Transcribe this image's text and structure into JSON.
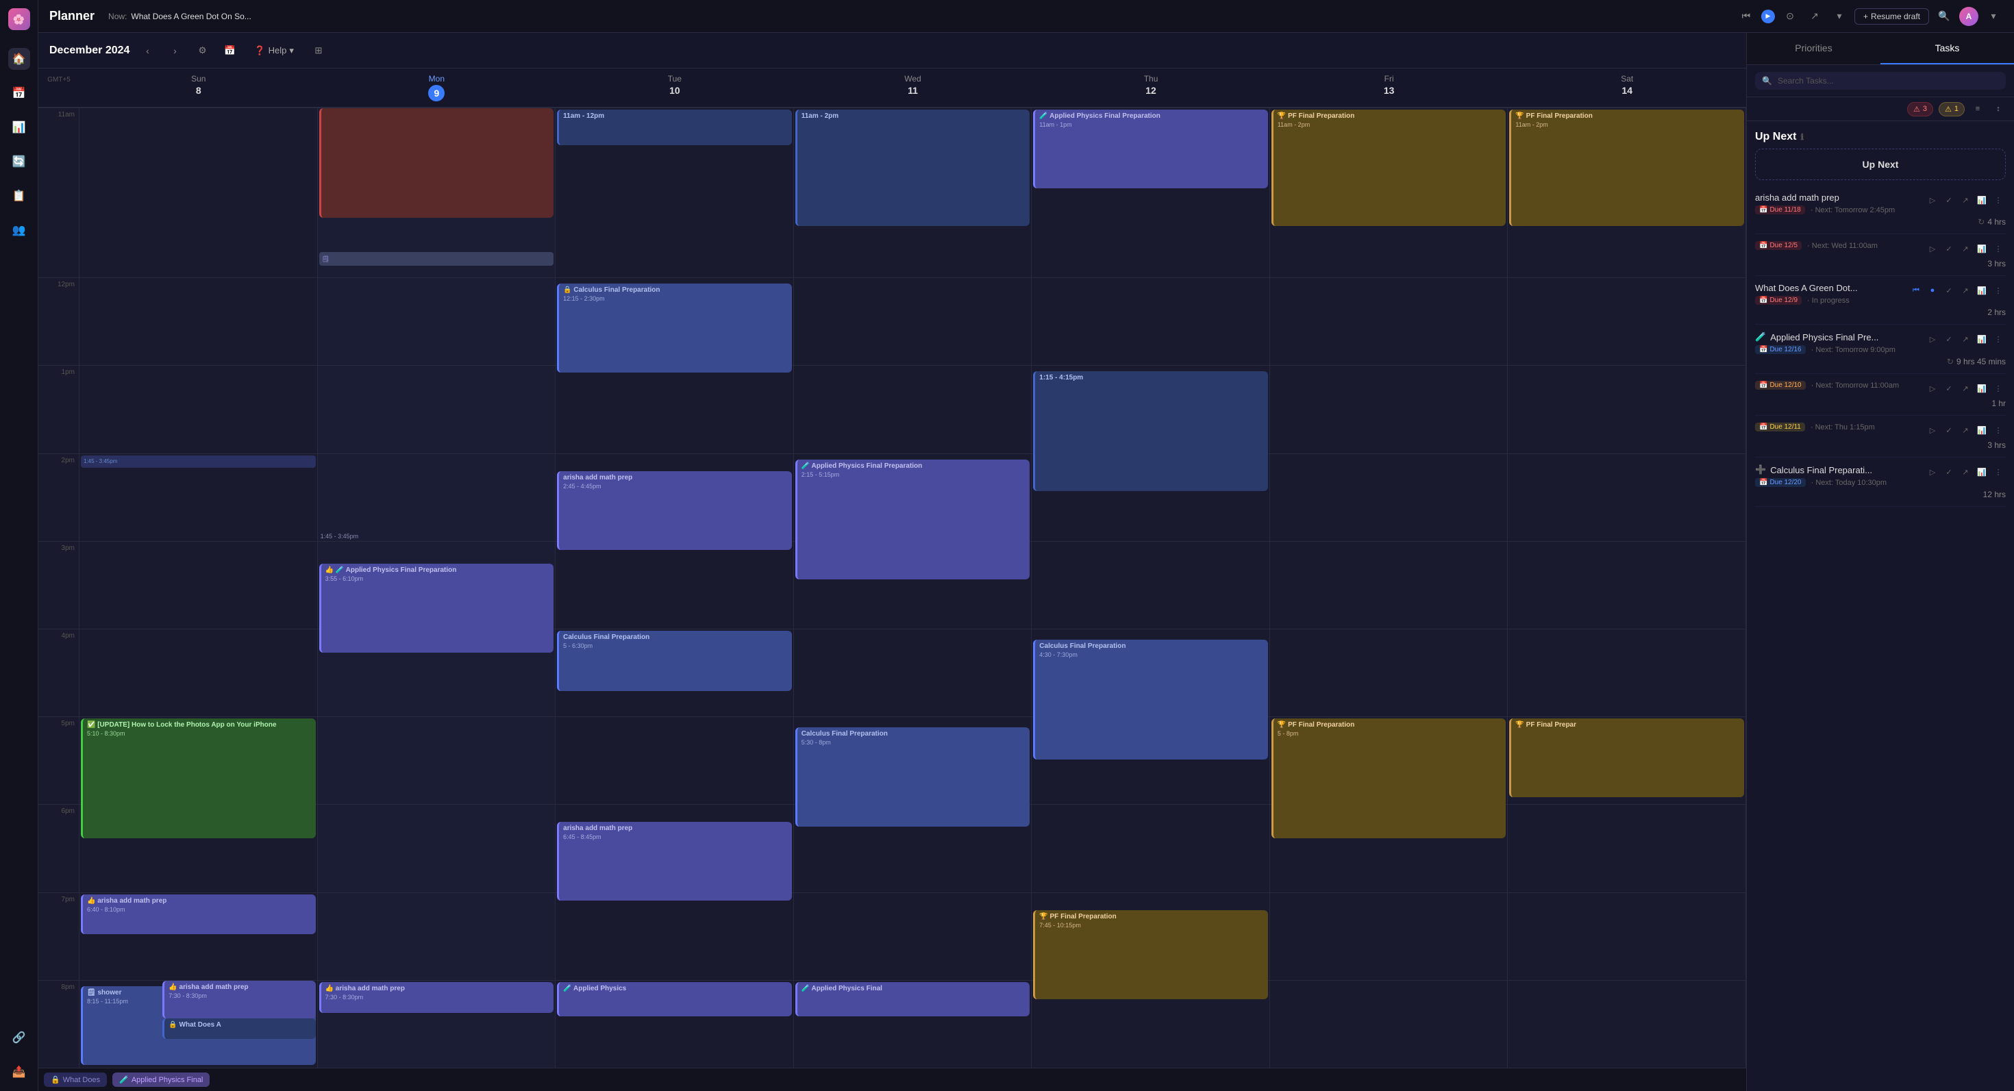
{
  "app": {
    "title": "Planner",
    "now_label": "Now:",
    "now_text": "What Does A Green Dot On So..."
  },
  "header_controls": {
    "resume_draft": "Resume draft",
    "search_placeholder": "Search Tasks..."
  },
  "calendar": {
    "month": "December 2024",
    "timezone": "GMT+5",
    "days": [
      {
        "name": "Sun",
        "num": "8",
        "today": false
      },
      {
        "name": "Mon",
        "num": "9",
        "today": true
      },
      {
        "name": "Tue",
        "num": "10",
        "today": false
      },
      {
        "name": "Wed",
        "num": "11",
        "today": false
      },
      {
        "name": "Thu",
        "num": "12",
        "today": false
      },
      {
        "name": "Fri",
        "num": "13",
        "today": false
      },
      {
        "name": "Sat",
        "num": "14",
        "today": false
      }
    ],
    "time_slots": [
      "11am",
      "12pm",
      "1pm",
      "2pm",
      "3pm",
      "4pm",
      "5pm",
      "6pm",
      "7pm",
      "8pm"
    ]
  },
  "panel": {
    "tabs": [
      "Priorities",
      "Tasks"
    ],
    "active_tab": "Tasks",
    "search_placeholder": "Search Tasks...",
    "filter_red_count": "3",
    "filter_yellow_count": "1"
  },
  "up_next": {
    "title": "Up Next",
    "box_text": "Up Next"
  },
  "tasks": [
    {
      "id": 1,
      "title": "arisha add math prep",
      "due_label": "Due 11/18",
      "due_class": "red",
      "next_text": "Next: Tomorrow 2:45pm",
      "hours": "4 hrs",
      "has_spinner": true,
      "emoji": "📅"
    },
    {
      "id": 2,
      "title": "",
      "due_label": "Due 12/5",
      "due_class": "red",
      "next_text": "Next: Wed 11:00am",
      "hours": "3 hrs",
      "has_spinner": false
    },
    {
      "id": 3,
      "title": "What Does A Green Dot...",
      "due_label": "Due 12/9",
      "due_class": "red",
      "next_text": "In progress",
      "hours": "2 hrs",
      "has_spinner": false,
      "is_active": true
    },
    {
      "id": 4,
      "title": "Applied Physics Final Pre...",
      "due_label": "Due 12/16",
      "due_class": "blue",
      "next_text": "Next: Tomorrow 9:00pm",
      "hours": "9 hrs 45 mins",
      "has_spinner": true,
      "emoji": "🧪"
    },
    {
      "id": 5,
      "title": "",
      "due_label": "Due 12/10",
      "due_class": "orange",
      "next_text": "Next: Tomorrow 11:00am",
      "hours": "1 hr",
      "has_spinner": false
    },
    {
      "id": 6,
      "title": "",
      "due_label": "Due 12/11",
      "due_class": "yellow",
      "next_text": "Next: Thu 1:15pm",
      "hours": "3 hrs",
      "has_spinner": false
    },
    {
      "id": 7,
      "title": "Calculus Final Preparati...",
      "due_label": "Due 12/20",
      "due_class": "blue",
      "next_text": "Next: Today 10:30pm",
      "hours": "12 hrs",
      "has_spinner": false,
      "emoji": "➕"
    }
  ],
  "sidebar_icons": [
    "🏠",
    "📅",
    "📊",
    "🔄",
    "📋",
    "👥",
    "🔗",
    "📤"
  ],
  "events": {
    "sun": [
      {
        "title": "[UPDATE] How to Lock the Photos App on Your iPhone",
        "time": "5:10 - 8:30pm",
        "color": "green",
        "top_pct": 73,
        "height_pct": 50
      },
      {
        "title": "arisha add math prep",
        "time": "6:40 - 8:10pm",
        "color": "purple",
        "top_pct": 87,
        "height_pct": 24
      },
      {
        "title": "arisha add math prep",
        "time": "7:30 - 8:30pm",
        "color": "purple",
        "top_pct": 97,
        "height_pct": 16
      },
      {
        "title": "shower",
        "time": "8:15 - 11:15pm",
        "color": "blue",
        "top_pct": 106,
        "height_pct": 42
      },
      {
        "title": "What Does A",
        "time": "",
        "color": "dark-blue",
        "top_pct": 110,
        "height_pct": 15
      }
    ],
    "mon": [
      {
        "title": "Applied Physics Final Preparation",
        "time": "3:55 - 6:10pm",
        "color": "purple",
        "top_pct": 60,
        "height_pct": 35
      }
    ],
    "tue": [
      {
        "title": "11am - 12pm",
        "time": "11am - 12pm",
        "color": "dark-blue",
        "top_pct": 0,
        "height_pct": 14
      },
      {
        "title": "🔒 Calculus Final Preparation",
        "time": "12:15 - 2:30pm",
        "color": "blue",
        "top_pct": 16,
        "height_pct": 33
      },
      {
        "title": "arisha add math prep",
        "time": "2:45 - 4:45pm",
        "color": "purple",
        "top_pct": 56,
        "height_pct": 28
      },
      {
        "title": "Calculus Final Preparation",
        "time": "5 - 6:30pm",
        "color": "blue",
        "top_pct": 83,
        "height_pct": 21
      },
      {
        "title": "arisha add math prep",
        "time": "6:45 - 8:45pm",
        "color": "purple",
        "top_pct": 103,
        "height_pct": 28
      }
    ],
    "wed": [
      {
        "title": "11am - 2pm",
        "time": "11am - 2pm",
        "color": "dark-blue",
        "top_pct": 0,
        "height_pct": 42
      },
      {
        "title": "🧪 Applied Physics Final Preparation",
        "time": "2:15 - 5:15pm",
        "color": "purple",
        "top_pct": 42,
        "height_pct": 42
      },
      {
        "title": "Calculus Final Preparation",
        "time": "5:30 - 8pm",
        "color": "blue",
        "top_pct": 83,
        "height_pct": 35
      },
      {
        "title": "🧪 Applied Physics Final",
        "time": "",
        "color": "purple",
        "top_pct": 116,
        "height_pct": 18
      }
    ],
    "thu": [
      {
        "title": "🧪 Applied Physics Final Preparation",
        "time": "11am - 1pm",
        "color": "purple",
        "top_pct": 0,
        "height_pct": 28
      },
      {
        "title": "1:15 - 4:15pm",
        "time": "1:15 - 4:15pm",
        "color": "dark-blue",
        "top_pct": 32,
        "height_pct": 42
      },
      {
        "title": "Calculus Final Preparation",
        "time": "4:30 - 7:30pm",
        "color": "blue",
        "top_pct": 78,
        "height_pct": 42
      },
      {
        "title": "🏆 PF Final Preparation",
        "time": "7:45 - 10:15pm",
        "color": "orange",
        "top_pct": 118,
        "height_pct": 35
      }
    ],
    "fri": [
      {
        "title": "🏆 PF Final Preparation",
        "time": "11am - 2pm",
        "color": "orange",
        "top_pct": 0,
        "height_pct": 42
      },
      {
        "title": "🏆 PF Final Preparation",
        "time": "5 - 8pm",
        "color": "orange",
        "top_pct": 83,
        "height_pct": 42
      }
    ],
    "sat": [
      {
        "title": "🏆 PF Final Preparation",
        "time": "11am - 2pm",
        "color": "orange",
        "top_pct": 0,
        "height_pct": 42
      },
      {
        "title": "🏆 PF Final Prepar",
        "time": "",
        "color": "orange",
        "top_pct": 83,
        "height_pct": 28
      }
    ]
  }
}
